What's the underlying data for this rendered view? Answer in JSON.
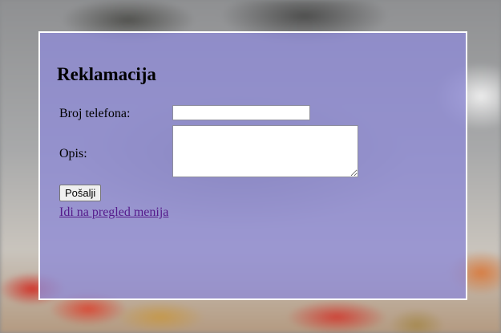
{
  "form": {
    "title": "Reklamacija",
    "phone_label": "Broj telefona:",
    "phone_value": "",
    "description_label": "Opis:",
    "description_value": "",
    "submit_label": "Pošalji",
    "menu_link_label": "Idi na pregled menija"
  }
}
